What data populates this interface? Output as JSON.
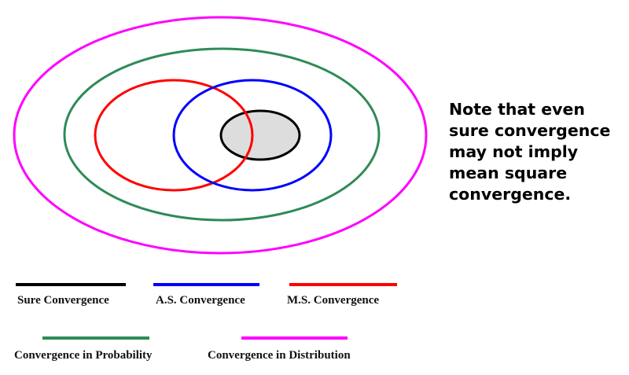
{
  "colors": {
    "sure": "#000000",
    "as": "#0000ff",
    "ms": "#ff0000",
    "probability": "#2e8b57",
    "distribution": "#ff00ff",
    "sure_fill": "#dddddd"
  },
  "note": [
    "Note that even",
    "sure convergence",
    "may not imply",
    "mean square",
    "convergence."
  ],
  "legend": [
    {
      "label": "Sure Convergence",
      "color_key": "sure"
    },
    {
      "label": "A.S. Convergence",
      "color_key": "as"
    },
    {
      "label": "M.S. Convergence",
      "color_key": "ms"
    },
    {
      "label": "Convergence in Probability",
      "color_key": "probability"
    },
    {
      "label": "Convergence in Distribution",
      "color_key": "distribution"
    }
  ]
}
